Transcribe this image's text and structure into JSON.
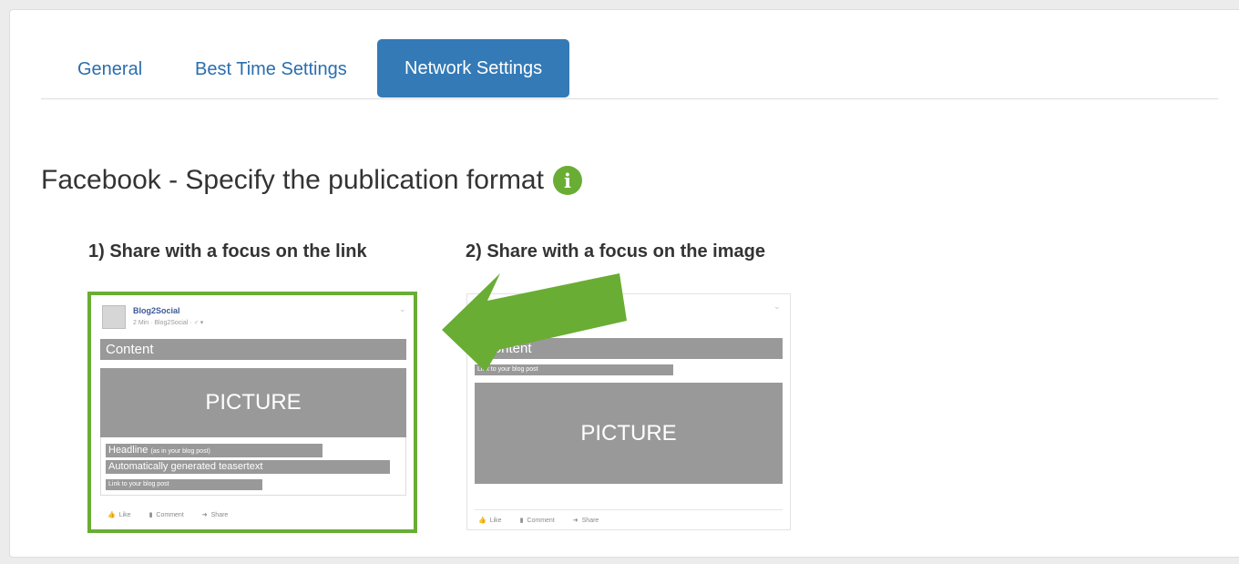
{
  "tabs": [
    {
      "label": "General",
      "active": false
    },
    {
      "label": "Best Time Settings",
      "active": false
    },
    {
      "label": "Network Settings",
      "active": true
    }
  ],
  "heading": "Facebook - Specify the publication format",
  "info_icon_glyph": "i",
  "options": [
    {
      "label": "1) Share with a focus on the link",
      "selected": true,
      "page_name": "Blog2Social",
      "meta": "2 Min · Blog2Social · ♂ ▾",
      "content": "Content",
      "picture": "PICTURE",
      "headline": "Headline",
      "headline_note": "(as in your blog post)",
      "teaser": "Automatically generated teasertext",
      "link": "Link to your blog post",
      "actions": {
        "like": "Like",
        "comment": "Comment",
        "share": "Share"
      }
    },
    {
      "label": "2) Share with a focus on the image",
      "selected": false,
      "content": "Content",
      "link": "Link to your blog post",
      "picture": "PICTURE",
      "actions": {
        "like": "Like",
        "comment": "Comment",
        "share": "Share"
      }
    }
  ],
  "colors": {
    "accent": "#337ab7",
    "selection": "#6aad34",
    "placeholder": "#999999"
  }
}
